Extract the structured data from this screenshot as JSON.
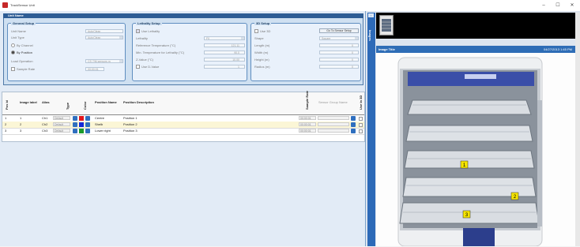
{
  "window": {
    "title": "TrackSensor Unit",
    "minimize": "–",
    "maximize": "☐",
    "close": "✕"
  },
  "unit": {
    "header": "Unit Name"
  },
  "general": {
    "title": "General Setup",
    "unit_name_label": "Unit Name",
    "unit_name_value": "AutoClean",
    "unit_type_label": "Unit Type",
    "unit_type_value": "AutoClean",
    "by_channel_label": "By Channel",
    "by_position_label": "By Position",
    "load_operation_label": "Load Operation",
    "load_operation_value": "CS 7/M sensors m",
    "sample_rate_label": "Sample Rate",
    "sample_rate_value": "00:00:01"
  },
  "lethality": {
    "title": "Lethality Setup",
    "use_lethality_label": "Use Lethality",
    "lethality_label": "Lethality",
    "lethality_value": "F0",
    "ref_temp_label": "Reference Temperature (°C)",
    "ref_temp_value": "121.11",
    "min_temp_label": "Min. Temperature for Lethality (°C)",
    "min_temp_value": "90.0",
    "zvalue_label": "Z-Value (°C)",
    "zvalue_value": "10.00",
    "use_d_label": "Use D-Value",
    "use_d_value": "1"
  },
  "sd": {
    "title": "3D Setup",
    "use3d_label": "Use 3D",
    "setup_btn": "Go To Sensor Setup",
    "shape_label": "Shape",
    "shape_value": "Square",
    "length_label": "Length (m)",
    "length_value": "0",
    "width_label": "Width (m)",
    "width_value": "0",
    "height_label": "Height (m)",
    "height_value": "0",
    "radius_label": "Radius (m)",
    "radius_value": "0"
  },
  "table": {
    "headers": [
      "Pos Id",
      "Image label",
      "Alias",
      "Type",
      "Color",
      "Position Name",
      "Position Description",
      "Sample Rate",
      "Sensor Group Name",
      "Use in 3D"
    ],
    "rows": [
      {
        "pos": "1",
        "label": "1",
        "alias": "Ch1",
        "type": "Default",
        "color": "#e3161b",
        "name": "Centre",
        "desc": "Position 1",
        "rate": "00:00:01"
      },
      {
        "pos": "2",
        "label": "2",
        "alias": "Ch2",
        "type": "Default",
        "color": "#1428d8",
        "name": "Shelb",
        "desc": "Position 2",
        "rate": "00:00:01"
      },
      {
        "pos": "3",
        "label": "3",
        "alias": "Ch3",
        "type": "Default",
        "color": "#1a9a2a",
        "name": "Lower right",
        "desc": "Position 3",
        "rate": "00:00:01"
      }
    ]
  },
  "right": {
    "strip_label": "Images",
    "image_title": "Image Title",
    "image_date": "04/27/2013 1:45 PM",
    "markers": [
      "1",
      "2",
      "3"
    ]
  },
  "colors": {
    "accent": "#2e6db6",
    "header": "#2e5d95",
    "highlight_row": "#fbf6d6"
  }
}
